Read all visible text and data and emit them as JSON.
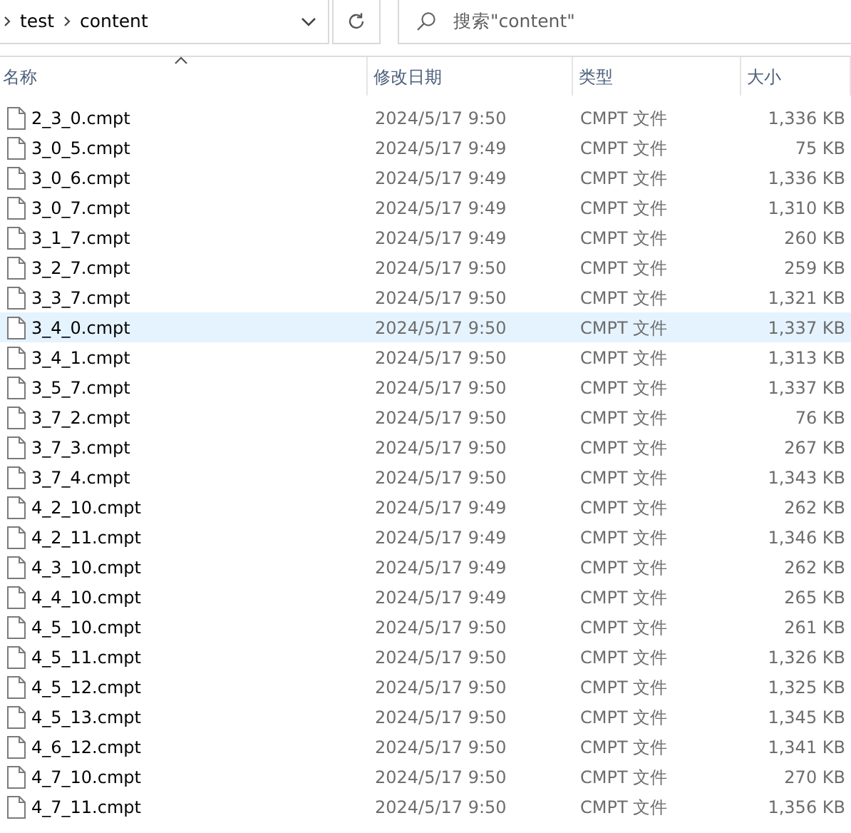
{
  "address_bar": {
    "path": [
      "test",
      "content"
    ]
  },
  "search": {
    "placeholder": "搜索\"content\""
  },
  "table": {
    "columns": [
      {
        "label": "名称",
        "sorted": true
      },
      {
        "label": "修改日期",
        "sorted": false
      },
      {
        "label": "类型",
        "sorted": false
      },
      {
        "label": "大小",
        "sorted": false
      }
    ],
    "rows": [
      {
        "name": "2_3_0.cmpt",
        "modified": "2024/5/17 9:50",
        "type": "CMPT 文件",
        "size": "1,336 KB",
        "selected": false
      },
      {
        "name": "3_0_5.cmpt",
        "modified": "2024/5/17 9:49",
        "type": "CMPT 文件",
        "size": "75 KB",
        "selected": false
      },
      {
        "name": "3_0_6.cmpt",
        "modified": "2024/5/17 9:49",
        "type": "CMPT 文件",
        "size": "1,336 KB",
        "selected": false
      },
      {
        "name": "3_0_7.cmpt",
        "modified": "2024/5/17 9:49",
        "type": "CMPT 文件",
        "size": "1,310 KB",
        "selected": false
      },
      {
        "name": "3_1_7.cmpt",
        "modified": "2024/5/17 9:49",
        "type": "CMPT 文件",
        "size": "260 KB",
        "selected": false
      },
      {
        "name": "3_2_7.cmpt",
        "modified": "2024/5/17 9:50",
        "type": "CMPT 文件",
        "size": "259 KB",
        "selected": false
      },
      {
        "name": "3_3_7.cmpt",
        "modified": "2024/5/17 9:50",
        "type": "CMPT 文件",
        "size": "1,321 KB",
        "selected": false
      },
      {
        "name": "3_4_0.cmpt",
        "modified": "2024/5/17 9:50",
        "type": "CMPT 文件",
        "size": "1,337 KB",
        "selected": true
      },
      {
        "name": "3_4_1.cmpt",
        "modified": "2024/5/17 9:50",
        "type": "CMPT 文件",
        "size": "1,313 KB",
        "selected": false
      },
      {
        "name": "3_5_7.cmpt",
        "modified": "2024/5/17 9:50",
        "type": "CMPT 文件",
        "size": "1,337 KB",
        "selected": false
      },
      {
        "name": "3_7_2.cmpt",
        "modified": "2024/5/17 9:50",
        "type": "CMPT 文件",
        "size": "76 KB",
        "selected": false
      },
      {
        "name": "3_7_3.cmpt",
        "modified": "2024/5/17 9:50",
        "type": "CMPT 文件",
        "size": "267 KB",
        "selected": false
      },
      {
        "name": "3_7_4.cmpt",
        "modified": "2024/5/17 9:50",
        "type": "CMPT 文件",
        "size": "1,343 KB",
        "selected": false
      },
      {
        "name": "4_2_10.cmpt",
        "modified": "2024/5/17 9:49",
        "type": "CMPT 文件",
        "size": "262 KB",
        "selected": false
      },
      {
        "name": "4_2_11.cmpt",
        "modified": "2024/5/17 9:49",
        "type": "CMPT 文件",
        "size": "1,346 KB",
        "selected": false
      },
      {
        "name": "4_3_10.cmpt",
        "modified": "2024/5/17 9:49",
        "type": "CMPT 文件",
        "size": "262 KB",
        "selected": false
      },
      {
        "name": "4_4_10.cmpt",
        "modified": "2024/5/17 9:49",
        "type": "CMPT 文件",
        "size": "265 KB",
        "selected": false
      },
      {
        "name": "4_5_10.cmpt",
        "modified": "2024/5/17 9:50",
        "type": "CMPT 文件",
        "size": "261 KB",
        "selected": false
      },
      {
        "name": "4_5_11.cmpt",
        "modified": "2024/5/17 9:50",
        "type": "CMPT 文件",
        "size": "1,326 KB",
        "selected": false
      },
      {
        "name": "4_5_12.cmpt",
        "modified": "2024/5/17 9:50",
        "type": "CMPT 文件",
        "size": "1,325 KB",
        "selected": false
      },
      {
        "name": "4_5_13.cmpt",
        "modified": "2024/5/17 9:50",
        "type": "CMPT 文件",
        "size": "1,345 KB",
        "selected": false
      },
      {
        "name": "4_6_12.cmpt",
        "modified": "2024/5/17 9:50",
        "type": "CMPT 文件",
        "size": "1,341 KB",
        "selected": false
      },
      {
        "name": "4_7_10.cmpt",
        "modified": "2024/5/17 9:50",
        "type": "CMPT 文件",
        "size": "270 KB",
        "selected": false
      },
      {
        "name": "4_7_11.cmpt",
        "modified": "2024/5/17 9:50",
        "type": "CMPT 文件",
        "size": "1,356 KB",
        "selected": false
      }
    ]
  }
}
